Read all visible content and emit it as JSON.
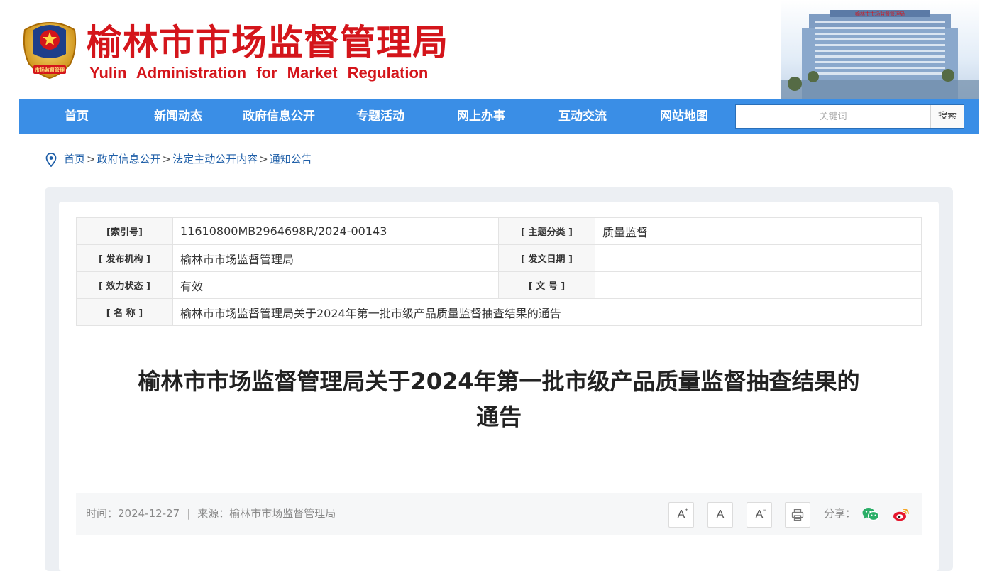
{
  "header": {
    "title_cn": "榆林市市场监督管理局",
    "title_en": "Yulin Administration for Market Regulation",
    "emblem_text": "市场监督管理",
    "building_sign": "榆林市市场监督管理局"
  },
  "nav": {
    "items": [
      "首页",
      "新闻动态",
      "政府信息公开",
      "专题活动",
      "网上办事",
      "互动交流",
      "网站地图"
    ],
    "search_placeholder": "关键词",
    "search_button": "搜索",
    "bar_color": "#3a8ee6"
  },
  "breadcrumb": {
    "icon": "location-pin-icon",
    "items": [
      "首页",
      "政府信息公开",
      "法定主动公开内容",
      "通知公告"
    ],
    "separator": ">"
  },
  "meta": {
    "index_label": "[索引号]",
    "index_value": "11610800MB2964698R/2024-00143",
    "topic_label": "[ 主题分类 ]",
    "topic_value": "质量监督",
    "publisher_label": "[ 发布机构 ]",
    "publisher_value": "榆林市市场监督管理局",
    "date_label": "[ 发文日期 ]",
    "date_value": "",
    "status_label": "[ 效力状态 ]",
    "status_value": "有效",
    "docno_label": "[ 文 号 ]",
    "docno_value": "",
    "name_label": "[ 名 称 ]",
    "name_value": "榆林市市场监督管理局关于2024年第一批市级产品质量监督抽查结果的通告"
  },
  "article": {
    "title_line1": "榆林市市场监督管理局关于2024年第一批市级产品质量监督抽查结果的",
    "title_line2": "通告"
  },
  "infobar": {
    "time_text": "时间：2024-12-27",
    "divider": "|",
    "source_text": "来源：榆林市市场监督管理局",
    "font_increase": "A",
    "font_increase_mark": "+",
    "font_normal": "A",
    "font_decrease": "A",
    "font_decrease_mark": "−",
    "print_icon": "printer-icon",
    "share_label": "分享：",
    "wechat_icon": "wechat-icon",
    "weibo_icon": "weibo-icon",
    "wechat_color": "#2aae67",
    "weibo_color": "#e6162d"
  },
  "colors": {
    "brand_red": "#d4151b",
    "link_blue": "#1f5fa8"
  }
}
